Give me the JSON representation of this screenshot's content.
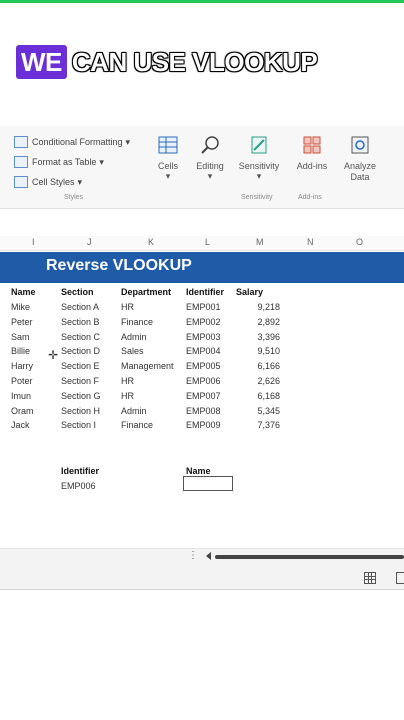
{
  "caption": {
    "highlight": "WE",
    "rest": "CAN USE VLOOKUP"
  },
  "ribbon": {
    "styles_items": [
      {
        "label": "Conditional Formatting",
        "icon": "conditional-formatting-icon",
        "has_dropdown": true
      },
      {
        "label": "Format as Table",
        "icon": "format-as-table-icon",
        "has_dropdown": true
      },
      {
        "label": "Cell Styles",
        "icon": "cell-styles-icon",
        "has_dropdown": true
      }
    ],
    "buttons": [
      {
        "label": "Cells",
        "icon": "cells-icon"
      },
      {
        "label": "Editing",
        "icon": "editing-icon"
      },
      {
        "label": "Sensitivity",
        "icon": "sensitivity-icon"
      },
      {
        "label": "Add-ins",
        "icon": "add-ins-icon"
      },
      {
        "label": "Analyze Data",
        "icon": "analyze-data-icon"
      }
    ],
    "groups": [
      "Styles",
      "Sensitivity",
      "Add-ins"
    ]
  },
  "columns": [
    "I",
    "J",
    "K",
    "L",
    "M",
    "N",
    "O"
  ],
  "sheet": {
    "title": "Reverse VLOOKUP",
    "headers": [
      "Name",
      "Section",
      "Department",
      "Identifier",
      "Salary"
    ],
    "rows": [
      [
        "Mike",
        "Section A",
        "HR",
        "EMP001",
        "9,218"
      ],
      [
        "Peter",
        "Section B",
        "Finance",
        "EMP002",
        "2,892"
      ],
      [
        "Sam",
        "Section C",
        "Admin",
        "EMP003",
        "3,396"
      ],
      [
        "Billie",
        "Section D",
        "Sales",
        "EMP004",
        "9,510"
      ],
      [
        "Harry",
        "Section E",
        "Management",
        "EMP005",
        "6,166"
      ],
      [
        "Poter",
        "Section F",
        "HR",
        "EMP006",
        "2,626"
      ],
      [
        "Imun",
        "Section G",
        "HR",
        "EMP007",
        "6,168"
      ],
      [
        "Oram",
        "Section H",
        "Admin",
        "EMP008",
        "5,345"
      ],
      [
        "Jack",
        "Section I",
        "Finance",
        "EMP009",
        "7,376"
      ]
    ],
    "lookup": {
      "identifier_label": "Identifier",
      "identifier_value": "EMP006",
      "name_label": "Name",
      "name_value": ""
    }
  },
  "colors": {
    "banner": "#1f5ba6",
    "caption_highlight": "#6a2fd6",
    "top_line": "#24c75a"
  }
}
